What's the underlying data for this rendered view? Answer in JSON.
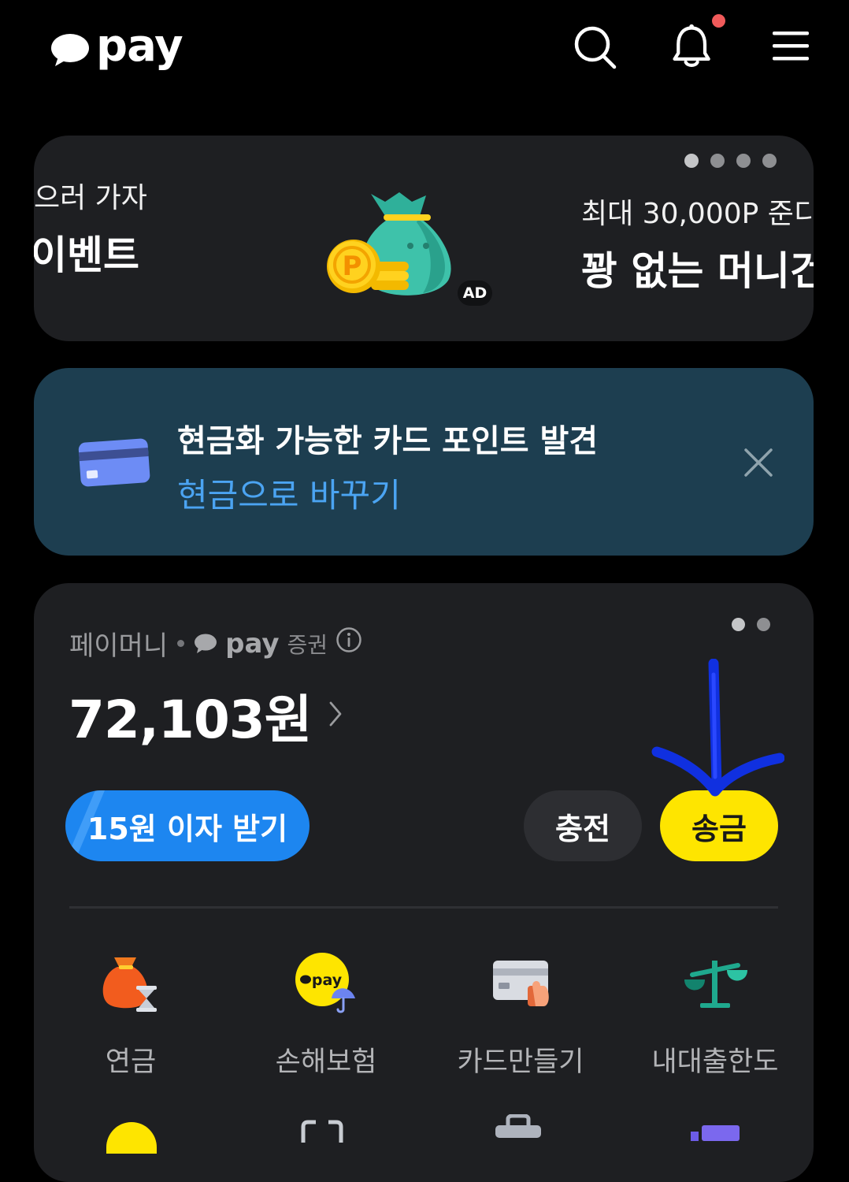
{
  "header": {
    "logo_text": "pay",
    "search_icon": "search-icon",
    "notification_icon": "bell-icon",
    "menu_icon": "hamburger-menu-icon",
    "notification_dot_color": "#f05a5a"
  },
  "ad_banner": {
    "left_subtitle": "으러 가자",
    "left_title": "이벤트",
    "right_subtitle": "최대 30,000P 준디",
    "right_title": "꽝 없는 머니건",
    "badge": "AD",
    "image_icon": "money-bag-coins-icon",
    "page_count": 4,
    "active_page": 1
  },
  "notice": {
    "title": "현금화 가능한 카드 포인트 발견",
    "link": "현금으로 바꾸기",
    "icon": "credit-card-icon",
    "close_icon": "close-icon"
  },
  "money": {
    "label": "페이머니",
    "provider_logo": "pay",
    "provider_suffix": "증권",
    "info_icon": "info-icon",
    "balance": "72,103원",
    "page_count": 2,
    "active_page": 1,
    "interest_button": "15원 이자 받기",
    "charge_button": "충전",
    "send_button": "송금",
    "services": [
      {
        "label": "연금",
        "icon": "pension-pouch-hourglass-icon"
      },
      {
        "label": "손해보험",
        "icon": "pay-umbrella-insurance-icon"
      },
      {
        "label": "카드만들기",
        "icon": "card-with-hand-icon"
      },
      {
        "label": "내대출한도",
        "icon": "scale-balance-icon"
      }
    ]
  },
  "colors": {
    "background": "#000000",
    "card": "#1e1f22",
    "notice_bg": "#1d3e50",
    "link_blue": "#4ba4f2",
    "interest_blue": "#1d86f0",
    "send_yellow": "#fee500",
    "annotation_arrow": "#1030e0"
  }
}
